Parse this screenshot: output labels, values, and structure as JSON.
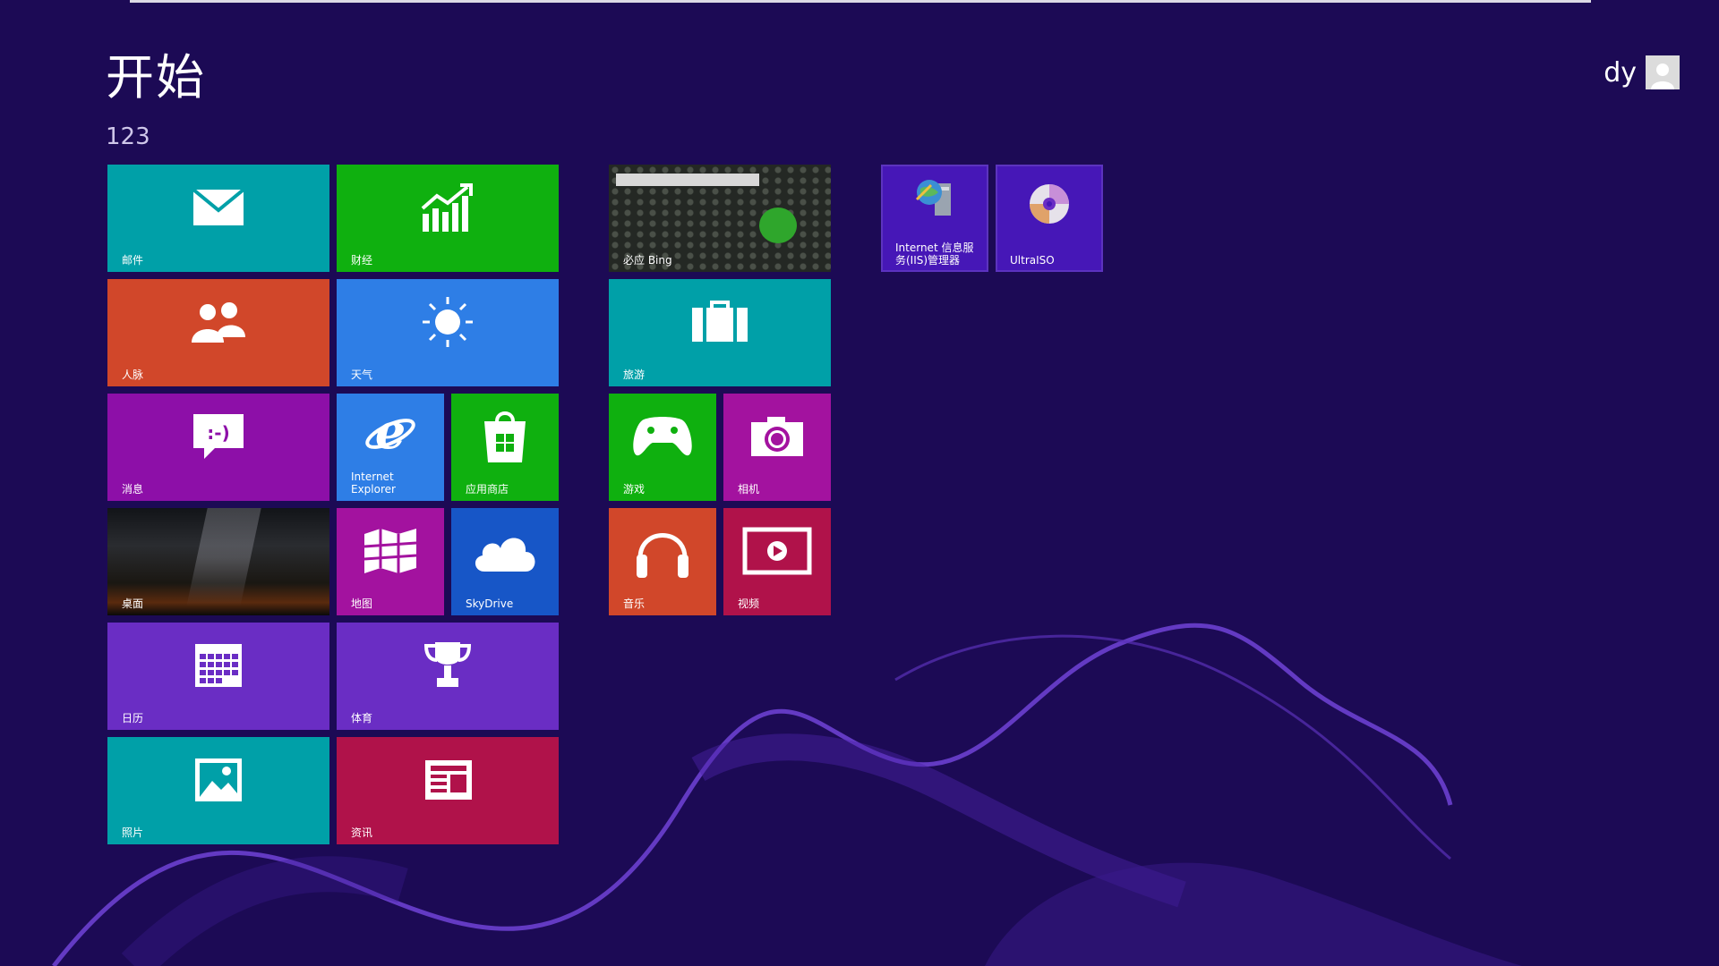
{
  "start": {
    "title": "开始",
    "group_name": "123",
    "user_name": "dy"
  },
  "tiles": {
    "mail": "邮件",
    "finance": "财经",
    "people": "人脉",
    "weather": "天气",
    "messaging": "消息",
    "ie": "Internet\nExplorer",
    "store": "应用商店",
    "desktop": "桌面",
    "maps": "地图",
    "skydrive": "SkyDrive",
    "calendar": "日历",
    "sports": "体育",
    "photos": "照片",
    "news": "资讯",
    "bing": "必应 Bing",
    "travel": "旅游",
    "games": "游戏",
    "camera": "相机",
    "music": "音乐",
    "video": "视频",
    "iis": "Internet 信息服务(IIS)管理器",
    "ultraiso": "UltraISO"
  },
  "colors": {
    "background": "#1c0a55",
    "teal": "#00a0a8",
    "green": "#0fb00f",
    "orange": "#d1472a",
    "blue": "#2e7ee6",
    "purple": "#8d0fa8",
    "magenta": "#a3129f",
    "darkblue": "#1756c7",
    "violet": "#6a2dc4",
    "crimson": "#b0124a",
    "indigo": "#4617b7"
  }
}
